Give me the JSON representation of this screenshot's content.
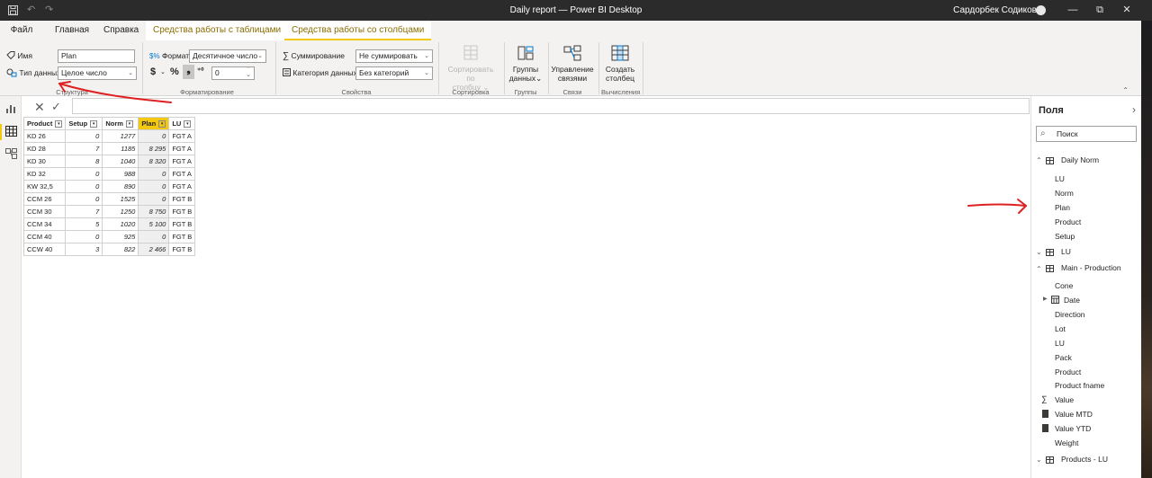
{
  "window": {
    "title": "Daily report — Power BI Desktop",
    "user": "Сардорбек Содиков",
    "controls": {
      "minimize": "—",
      "restore": "⧉",
      "close": "✕"
    }
  },
  "tabs": {
    "file": "Файл",
    "home": "Главная",
    "help": "Справка",
    "table_tools": "Средства работы с таблицами",
    "column_tools": "Средства работы со столбцами"
  },
  "ribbon": {
    "name_label": "Имя",
    "name_value": "Plan",
    "datatype_label": "Тип данных",
    "datatype_value": "Целое число",
    "structure_group": "Структура",
    "format_label": "Формат",
    "format_value": "Десятичное число",
    "currency": "$",
    "percent": "%",
    "comma": "❟",
    "decimals_value": "0",
    "formatting_group": "Форматирование",
    "summarization_label": "Суммирование",
    "summarization_value": "Не суммировать",
    "category_label": "Категория данных",
    "category_value": "Без категорий",
    "properties_group": "Свойства",
    "sort_by_column_line1": "Сортировать по",
    "sort_by_column_line2": "столбцу",
    "sort_group": "Сортировка",
    "data_groups_line1": "Группы",
    "data_groups_line2": "данных",
    "groups_group": "Группы",
    "manage_rel_line1": "Управление",
    "manage_rel_line2": "связями",
    "relationships_group": "Связи",
    "new_column_line1": "Создать",
    "new_column_line2": "столбец",
    "calculations_group": "Вычисления"
  },
  "grid": {
    "columns": [
      "Product",
      "Setup",
      "Norm",
      "Plan",
      "LU"
    ],
    "rows": [
      [
        "KD 26",
        "0",
        "1277",
        "0",
        "FGT A"
      ],
      [
        "KD 28",
        "7",
        "1185",
        "8 295",
        "FGT A"
      ],
      [
        "KD 30",
        "8",
        "1040",
        "8 320",
        "FGT A"
      ],
      [
        "KD 32",
        "0",
        "988",
        "0",
        "FGT A"
      ],
      [
        "KW 32,5",
        "0",
        "890",
        "0",
        "FGT A"
      ],
      [
        "CCM 26",
        "0",
        "1525",
        "0",
        "FGT B"
      ],
      [
        "CCM 30",
        "7",
        "1250",
        "8 750",
        "FGT B"
      ],
      [
        "CCM 34",
        "5",
        "1020",
        "5 100",
        "FGT B"
      ],
      [
        "CCM 40",
        "0",
        "925",
        "0",
        "FGT B"
      ],
      [
        "CCW 40",
        "3",
        "822",
        "2 466",
        "FGT B"
      ]
    ]
  },
  "fields": {
    "title": "Поля",
    "search_placeholder": "Поиск",
    "daily_norm": "Daily Norm",
    "daily_norm_fields": [
      "LU",
      "Norm",
      "Plan",
      "Product",
      "Setup"
    ],
    "lu_table": "LU",
    "main_production": "Main - Production",
    "mp_cone": "Cone",
    "mp_date": "Date",
    "mp_direction": "Direction",
    "mp_lot": "Lot",
    "mp_lu": "LU",
    "mp_pack": "Pack",
    "mp_product": "Product",
    "mp_product_fname": "Product fname",
    "mp_value": "Value",
    "mp_value_mtd": "Value MTD",
    "mp_value_ytd": "Value YTD",
    "mp_weight": "Weight",
    "products_lu": "Products - LU"
  },
  "colors": {
    "accent": "#f2c811",
    "annotation": "#e02020",
    "titlebar": "#2b2b2b"
  }
}
